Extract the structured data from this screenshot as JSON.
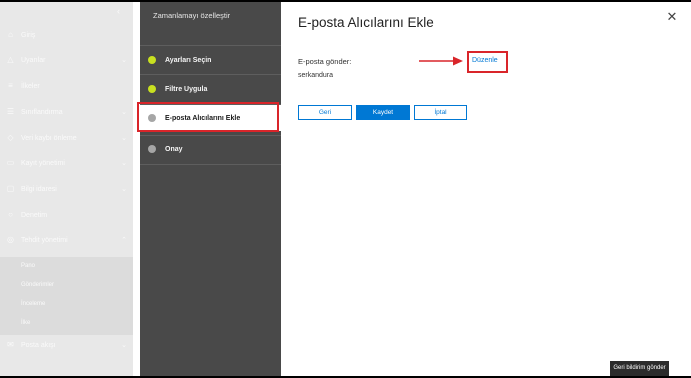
{
  "nav": {
    "items": [
      {
        "label": "Giriş",
        "icon": "home-icon",
        "glyph": "⌂",
        "chevron": false
      },
      {
        "label": "Uyarılar",
        "icon": "alert-icon",
        "glyph": "△",
        "chevron": true
      },
      {
        "label": "İlkeler",
        "icon": "policy-icon",
        "glyph": "≡",
        "chevron": false
      },
      {
        "label": "Sınıflandırma",
        "icon": "classification-icon",
        "glyph": "☰",
        "chevron": true
      },
      {
        "label": "Veri kaybı önleme",
        "icon": "shield-icon",
        "glyph": "◇",
        "chevron": true
      },
      {
        "label": "Kayıt yönetimi",
        "icon": "records-icon",
        "glyph": "▭",
        "chevron": true
      },
      {
        "label": "Bilgi idaresi",
        "icon": "lock-icon",
        "glyph": "▢",
        "chevron": true
      },
      {
        "label": "Denetim",
        "icon": "search-icon",
        "glyph": "○",
        "chevron": false
      },
      {
        "label": "Tehdit yönetimi",
        "icon": "threat-icon",
        "glyph": "◎",
        "chevron": true
      },
      {
        "label": "Pano",
        "sub": true
      },
      {
        "label": "Gönderimler",
        "sub": true
      },
      {
        "label": "İncelemе",
        "sub": true
      },
      {
        "label": "İlke",
        "sub": true
      },
      {
        "label": "Posta akışı",
        "icon": "mail-icon",
        "glyph": "✉",
        "chevron": true
      }
    ]
  },
  "wizard": {
    "title": "Zamanlamayı özelleştir",
    "steps": [
      {
        "label": "Ayarları Seçin",
        "status": "complete"
      },
      {
        "label": "Filtre Uygula",
        "status": "complete"
      },
      {
        "label": "E-posta Alıcılarını Ekle",
        "status": "current"
      },
      {
        "label": "Onay",
        "status": "pending"
      }
    ]
  },
  "main": {
    "title": "E-posta Alıcılarını Ekle",
    "send_label": "E-posta gönder:",
    "recipient": "serkandura",
    "edit_link": "Düzenle",
    "buttons": {
      "back": "Geri",
      "save": "Kaydet",
      "cancel": "İptal"
    }
  },
  "feedback": {
    "label": "Geri bildirim gönder"
  },
  "colors": {
    "accent": "#0078d4",
    "highlight": "#d9252a",
    "step_complete": "#c8e020",
    "step_pending": "#a6a6a6",
    "wizard_bg": "#494949"
  }
}
